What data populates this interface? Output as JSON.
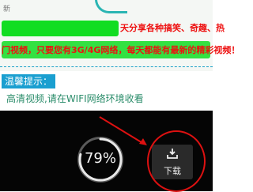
{
  "notice": {
    "top_text": "新",
    "line1_red": "天分享各种搞笑、奇趣、热",
    "line2_red": "门视频，只要您有3G/4G网络，每天都能有最新的精彩视频！"
  },
  "tip_label": "温馨提示：",
  "tip_text": "高清视频,请在WIFI网络环境收看",
  "video": {
    "progress_text": "79%",
    "progress": 0.79,
    "download_label": "下载"
  },
  "colors": {
    "accent": "#1a9fd0",
    "highlight": "#11dd22",
    "alert": "#ee1111"
  }
}
